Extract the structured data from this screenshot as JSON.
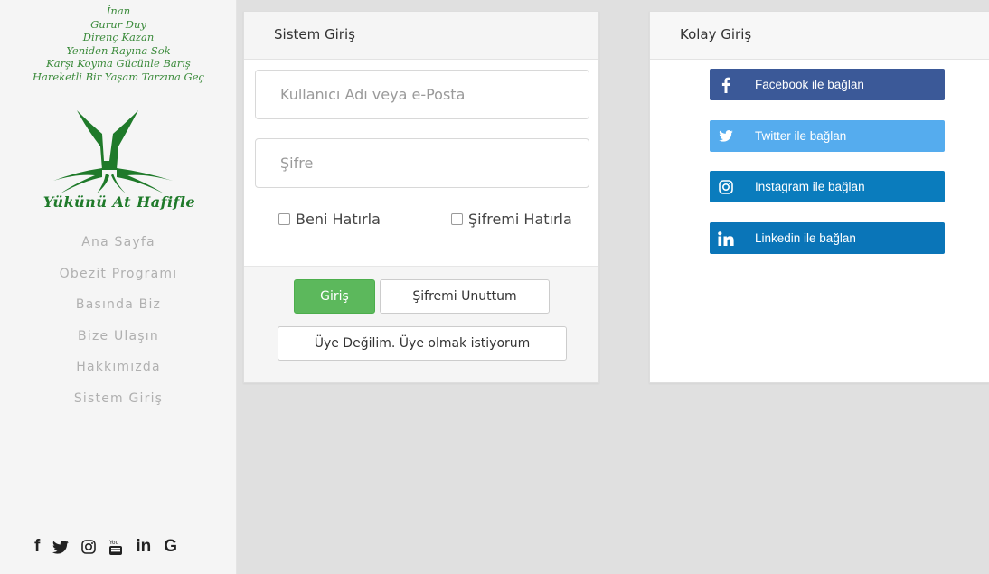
{
  "sidebar": {
    "motto": [
      "İnan",
      "Gurur Duy",
      "Direnç Kazan",
      "Yeniden Rayına Sok",
      "Karşı Koyma Gücünle Barış",
      "Hareketli Bir Yaşam Tarzına Geç"
    ],
    "brand": "Yükünü At Hafifle",
    "nav": [
      "Ana Sayfa",
      "Obezit Programı",
      "Basında Biz",
      "Bize Ulaşın",
      "Hakkımızda",
      "Sistem Giriş"
    ],
    "social_icons": [
      "facebook-icon",
      "twitter-icon",
      "instagram-icon",
      "youtube-icon",
      "linkedin-icon",
      "google-icon"
    ],
    "social_text": {
      "facebook": "f",
      "linkedin": "in",
      "google": "G"
    }
  },
  "login": {
    "title": "Sistem Giriş",
    "username_placeholder": "Kullanıcı Adı veya e-Posta",
    "password_placeholder": "Şifre",
    "remember_me": "Beni Hatırla",
    "remember_password": "Şifremi Hatırla",
    "login_button": "Giriş",
    "forgot_button": "Şifremi Unuttum",
    "register_button": "Üye Değilim. Üye olmak istiyorum"
  },
  "easy_login": {
    "title": "Kolay Giriş",
    "buttons": [
      {
        "label": "Facebook ile bağlan",
        "icon": "facebook-icon",
        "color": "#3b5998"
      },
      {
        "label": "Twitter ile bağlan",
        "icon": "twitter-icon",
        "color": "#55acee"
      },
      {
        "label": "Instagram ile bağlan",
        "icon": "instagram-icon",
        "color": "#0a7cbd"
      },
      {
        "label": "Linkedin ile bağlan",
        "icon": "linkedin-icon",
        "color": "#0a75b8"
      }
    ]
  },
  "colors": {
    "accent_green": "#5cb85c",
    "brand_green": "#1f7a2a",
    "background": "#e0e0e0"
  }
}
